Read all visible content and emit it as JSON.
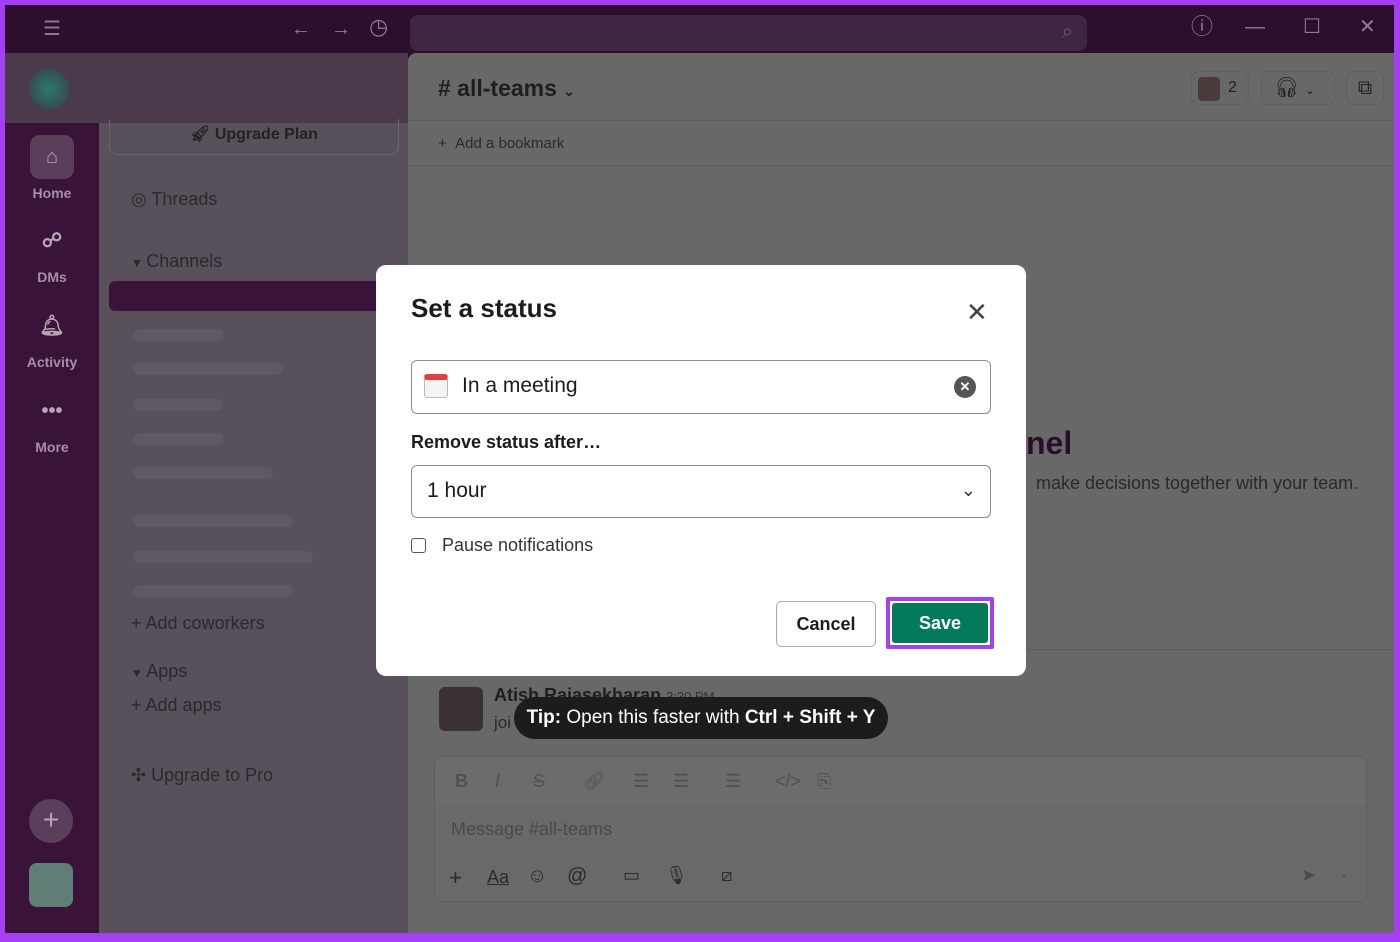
{
  "titlebar": {
    "menu_icon": "hamburger-icon",
    "back_icon": "arrow-left-icon",
    "forward_icon": "arrow-right-icon",
    "history_icon": "clock-icon",
    "search_icon": "search-icon",
    "help_icon": "question-icon"
  },
  "rail": {
    "items": [
      {
        "label": "Home",
        "icon": "home-icon"
      },
      {
        "label": "DMs",
        "icon": "dms-icon"
      },
      {
        "label": "Activity",
        "icon": "bell-icon"
      },
      {
        "label": "More",
        "icon": "more-icon"
      }
    ]
  },
  "sidebar": {
    "upgrade_plan": "Upgrade Plan",
    "threads": "Threads",
    "channels": "Channels",
    "add_coworkers": "Add coworkers",
    "apps": "Apps",
    "add_apps": "Add apps",
    "upgrade_pro": "Upgrade to Pro"
  },
  "channel": {
    "name": "# all-teams",
    "member_count": "2",
    "bookmark": "Add a bookmark",
    "partial_title": "nel",
    "partial_desc": "make decisions together with your team."
  },
  "message": {
    "author": "Atish Rajasekharan",
    "time": "3:30 PM",
    "text": "joi"
  },
  "composer": {
    "placeholder": "Message #all-teams",
    "format_label": "Aa"
  },
  "modal": {
    "title": "Set a status",
    "status_value": "In a meeting",
    "status_emoji": "calendar-icon",
    "remove_label": "Remove status after…",
    "duration": "1 hour",
    "pause_label": "Pause notifications",
    "pause_checked": false,
    "cancel": "Cancel",
    "save": "Save",
    "save_color": "#007a5a",
    "highlight_color": "#a43ff5"
  },
  "tip": {
    "prefix": "Tip:",
    "text": " Open this faster with ",
    "shortcut": "Ctrl + Shift + Y"
  }
}
